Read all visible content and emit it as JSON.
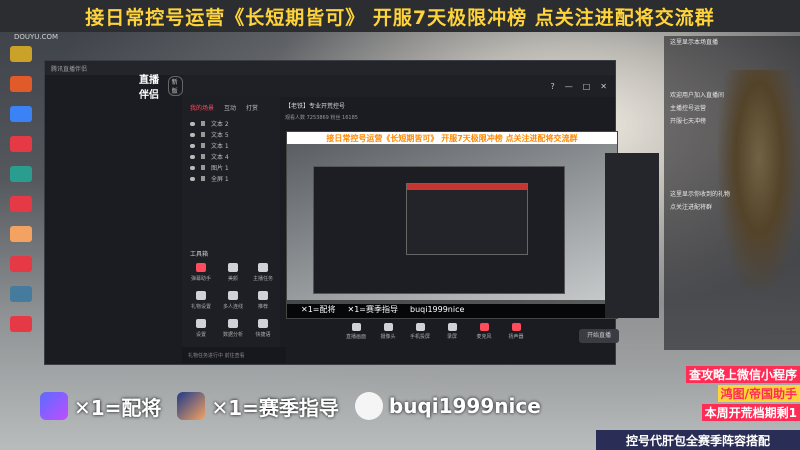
{
  "banner": {
    "text": "接日常控号运营《长短期皆可》  开服7天极限冲榜  点关注进配将交流群"
  },
  "watermark": "DOUYU.COM",
  "app": {
    "titlebar": "腾讯直播伴侣",
    "logo": "直播伴侣",
    "version": "新版",
    "side_tabs": [
      "我的场景",
      "互动",
      "打赏"
    ],
    "scenes": [
      "文本 2",
      "文本 5",
      "文本 1",
      "文本 4",
      "图片 1",
      "全屏 1"
    ],
    "tools_title": "工具箱",
    "tools": [
      "弹幕助手",
      "美颜",
      "主播任务",
      "礼物设置",
      "多人连线",
      "推荐",
      "设置",
      "数据分析",
      "快捷语"
    ],
    "bottom_strip": "礼物任务进行中 前往查看",
    "head_title": "【老铁】专业开荒控号",
    "head_sub": "观看人数 7253869  粉丝 16185",
    "preview_banner": "接日常控号运营《长短期皆可》  开服7天极限冲榜  点关注进配将交流群",
    "preview_bottom": [
      "✕1=配将",
      "✕1=赛季指导",
      "buqi1999nice"
    ],
    "controls": [
      "直播画面",
      "摄像头",
      "手机投屏",
      "录屏",
      "麦克风",
      "扬声器"
    ],
    "start_label": "开始直播",
    "window_controls": [
      "?",
      "—",
      "□",
      "✕"
    ]
  },
  "chat": [
    "这里显示本场直播",
    "欢迎用户加入直播间",
    "主播控号运营",
    "开服七天冲榜",
    "这里显示你收到的礼物",
    "点关注进配将群"
  ],
  "promo": [
    "查攻略上微信小程序",
    "鸿图/帝国助手",
    "本周开荒档期剩1"
  ],
  "footer": [
    "✕1=配将",
    "✕1=赛季指导",
    "buqi1999nice"
  ],
  "bottom_bar": "控号代肝包全赛季阵容搭配"
}
